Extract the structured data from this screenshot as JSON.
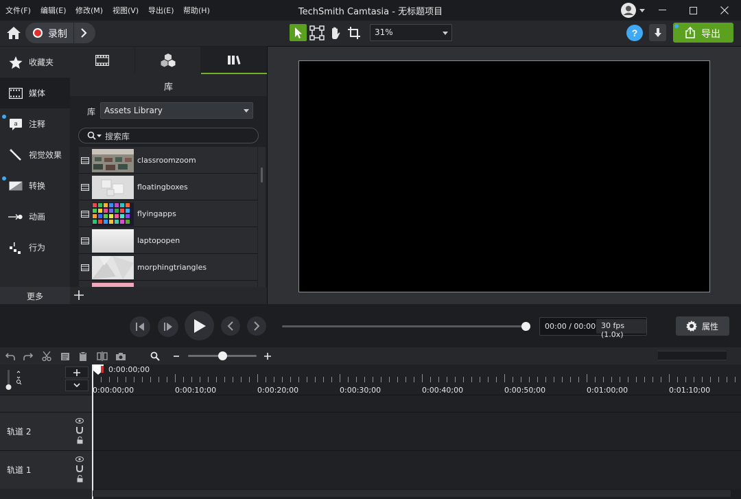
{
  "window": {
    "title": "TechSmith Camtasia - 无标题项目",
    "menu": [
      "文件(F)",
      "编辑(E)",
      "修改(M)",
      "视图(V)",
      "导出(E)",
      "帮助(H)"
    ]
  },
  "toolbar": {
    "record_label": "录制",
    "zoom_value": "31%",
    "export_label": "导出"
  },
  "tools": [
    {
      "label": "收藏夹",
      "icon": "star-icon"
    },
    {
      "label": "媒体",
      "icon": "film-icon"
    },
    {
      "label": "注释",
      "icon": "annotation-icon"
    },
    {
      "label": "视觉效果",
      "icon": "magic-wand-icon"
    },
    {
      "label": "转换",
      "icon": "transition-icon"
    },
    {
      "label": "动画",
      "icon": "animation-arrow-icon"
    },
    {
      "label": "行为",
      "icon": "behavior-icon"
    }
  ],
  "more_label": "更多",
  "library": {
    "header": "库",
    "row_label": "库",
    "selected": "Assets Library",
    "search_placeholder": "搜索库",
    "assets": [
      {
        "name": "classroomzoom"
      },
      {
        "name": "floatingboxes"
      },
      {
        "name": "flyingapps"
      },
      {
        "name": "laptopopen"
      },
      {
        "name": "morphingtriangles"
      }
    ]
  },
  "playback": {
    "time": "00:00 / 00:00",
    "fps": "30 fps (1.0x)",
    "properties_label": "属性",
    "scrub_position": 1.0
  },
  "timeline": {
    "playhead": "0:00:00;00",
    "ticks": [
      "0:00:00;00",
      "0:00:10;00",
      "0:00:20;00",
      "0:00:30;00",
      "0:00:40;00",
      "0:00:50;00",
      "0:01:00;00",
      "0:01:10;00"
    ],
    "tracks": [
      {
        "label": "轨道 2"
      },
      {
        "label": "轨道 1"
      }
    ],
    "zoom_level": 0.5
  },
  "colors": {
    "accent": "#74b328",
    "export": "#5ba01f",
    "help": "#3fa9f5",
    "record": "#e0312f"
  }
}
